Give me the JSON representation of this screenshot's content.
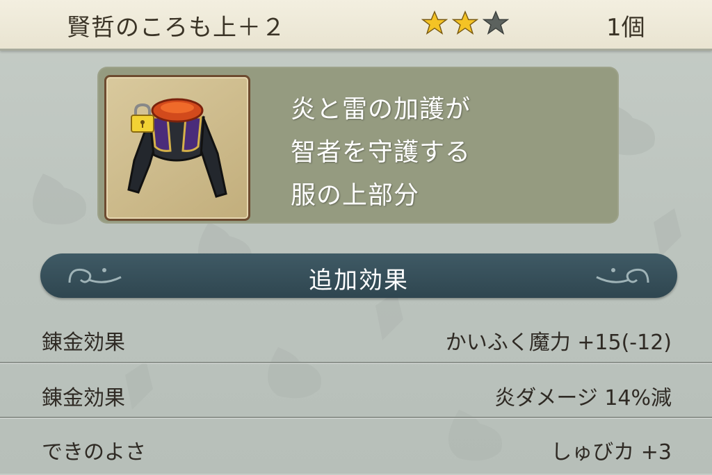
{
  "header": {
    "item_name": "賢哲のころも上＋２",
    "stars": {
      "filled": 2,
      "total": 3,
      "filled_color": "#f4c325",
      "empty_color": "#5c625e"
    },
    "count": "1個"
  },
  "item": {
    "icon": "purple-robe-top-icon",
    "locked": true,
    "description": [
      "炎と雷の加護が",
      "智者を守護する",
      "服の上部分"
    ]
  },
  "section": {
    "title": "追加効果"
  },
  "effects": [
    {
      "label": "錬金効果",
      "value": "かいふく魔力 +15(-12)"
    },
    {
      "label": "錬金効果",
      "value": "炎ダメージ 14%減"
    },
    {
      "label": "できのよさ",
      "value": "しゅびカ +3"
    }
  ],
  "colors": {
    "header_bg": "#ede8d6",
    "panel_bg": "#959b80",
    "section_bar": "#34505b",
    "text_dark": "#2f2a24"
  }
}
